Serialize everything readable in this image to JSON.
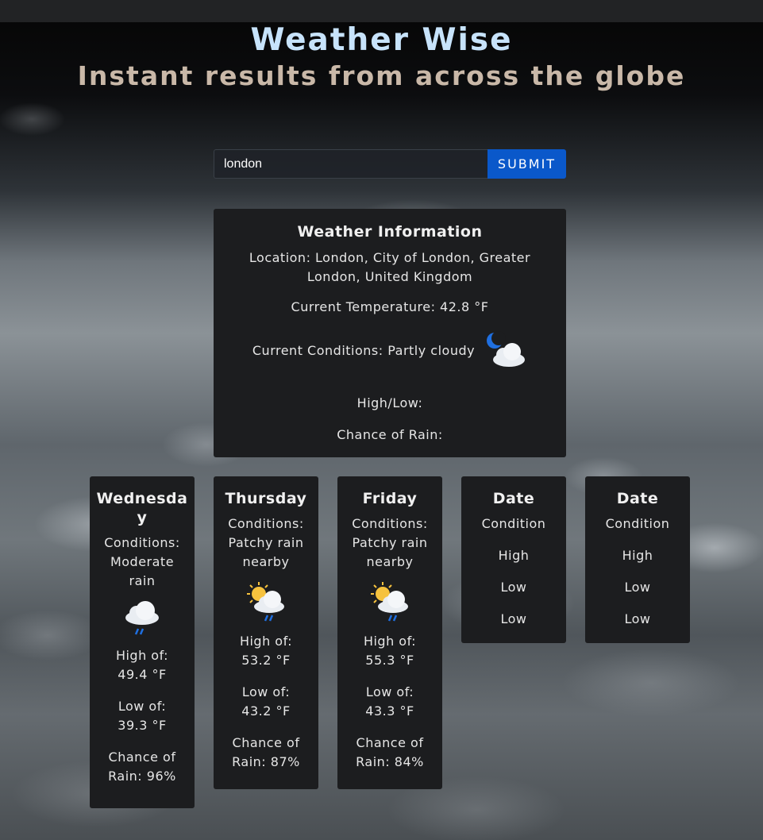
{
  "app": {
    "title": "Weather Wise",
    "subtitle": "Instant results from across the globe",
    "colors": {
      "title": "#c7e3fb",
      "subtitle": "#c9b8a8",
      "accent": "#0a58ca",
      "panel": "#1c1d1f"
    }
  },
  "search": {
    "value": "london",
    "submit_label": "SUBMIT"
  },
  "current": {
    "heading": "Weather Information",
    "location_text": "Location: London, City of London, Greater London, United Kingdom",
    "temperature_text": "Current Temperature: 42.8 °F",
    "conditions_text": "Current Conditions: Partly cloudy",
    "conditions_icon": "partly-cloudy-night-icon",
    "highlow_text": "High/Low:",
    "rain_text": "Chance of Rain:"
  },
  "forecast": [
    {
      "day": "Wednesday",
      "conditions_label": "Conditions:",
      "conditions": "Moderate rain",
      "icon": "rain-cloud-icon",
      "high_label": "High of:",
      "high": "49.4 °F",
      "low_label": "Low of:",
      "low": "39.3 °F",
      "rain_label": "Chance of",
      "rain": "Rain: 96%"
    },
    {
      "day": "Thursday",
      "conditions_label": "Conditions:",
      "conditions": "Patchy rain nearby",
      "icon": "sun-rain-cloud-icon",
      "high_label": "High of:",
      "high": "53.2 °F",
      "low_label": "Low of:",
      "low": "43.2 °F",
      "rain_label": "Chance of",
      "rain": "Rain: 87%"
    },
    {
      "day": "Friday",
      "conditions_label": "Conditions:",
      "conditions": "Patchy rain nearby",
      "icon": "sun-rain-cloud-icon",
      "high_label": "High of:",
      "high": "55.3 °F",
      "low_label": "Low of:",
      "low": "43.3 °F",
      "rain_label": "Chance of",
      "rain": "Rain: 84%"
    },
    {
      "day": "Date",
      "condition": "Condition",
      "high": "High",
      "low": "Low",
      "low2": "Low"
    },
    {
      "day": "Date",
      "condition": "Condition",
      "high": "High",
      "low": "Low",
      "low2": "Low"
    }
  ]
}
